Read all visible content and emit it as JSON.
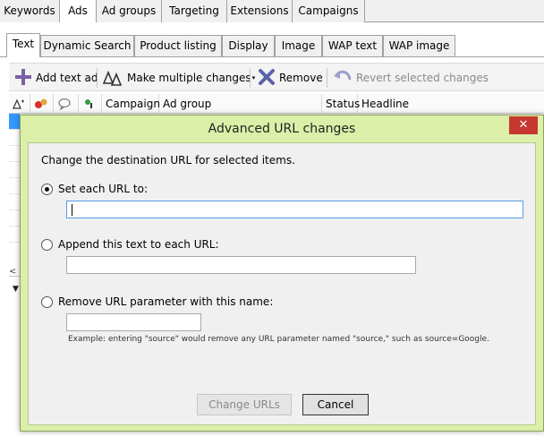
{
  "top_tabs": [
    {
      "label": "Keywords"
    },
    {
      "label": "Ads"
    },
    {
      "label": "Ad groups"
    },
    {
      "label": "Targeting"
    },
    {
      "label": "Extensions"
    },
    {
      "label": "Campaigns"
    }
  ],
  "active_top_tab": "Ads",
  "sub_tabs": [
    {
      "label": "Text"
    },
    {
      "label": "Dynamic Search"
    },
    {
      "label": "Product listing"
    },
    {
      "label": "Display"
    },
    {
      "label": "Image"
    },
    {
      "label": "WAP text"
    },
    {
      "label": "WAP image"
    }
  ],
  "active_sub_tab": "Text",
  "toolbar": {
    "add_text_ad": "Add text ad",
    "make_multiple_changes": "Make multiple changes",
    "remove": "Remove",
    "revert_selected_changes": "Revert selected changes"
  },
  "grid": {
    "columns": [
      "Campaign",
      "Ad group",
      "Status",
      "Headline"
    ]
  },
  "dialog": {
    "title": "Advanced URL changes",
    "close_symbol": "✕",
    "description": "Change the destination URL for selected items.",
    "option_set": "Set each URL to:",
    "option_append": "Append this text to each URL:",
    "option_remove": "Remove URL parameter with this name:",
    "set_value": "",
    "append_value": "",
    "remove_value": "",
    "example": "Example: entering \"source\" would remove any URL parameter named \"source,\" such as source=Google.",
    "change_urls_button": "Change URLs",
    "cancel_button": "Cancel",
    "selected_option": "set"
  },
  "colors": {
    "dialog_frame": "#dcefa8",
    "close_button": "#c7372f",
    "selection": "#3399ff",
    "add_icon": "#7b5fa8",
    "remove_icon": "#5b63a8"
  }
}
